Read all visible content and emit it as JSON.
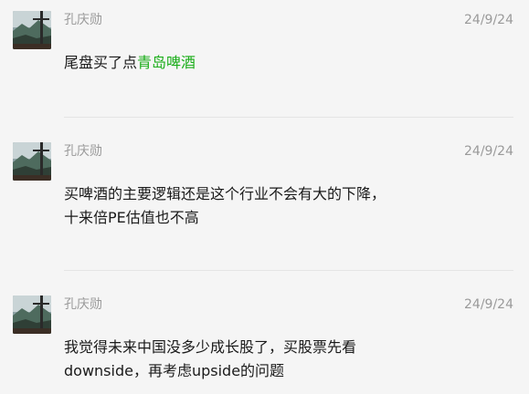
{
  "messages": [
    {
      "author": "孔庆勋",
      "time": "24/9/24",
      "text_before": "尾盘买了点",
      "highlight": "青岛啤酒",
      "highlight_color": "#1aad19"
    },
    {
      "author": "孔庆勋",
      "time": "24/9/24",
      "line1": "买啤酒的主要逻辑还是这个行业不会有大的下降，",
      "line2": "十来倍PE估值也不高"
    },
    {
      "author": "孔庆勋",
      "time": "24/9/24",
      "line1": "我觉得未来中国没多少成长股了，买股票先看",
      "line2": "downside，再考虑upside的问题"
    }
  ],
  "avatar_icon": "landscape-avatar-icon"
}
